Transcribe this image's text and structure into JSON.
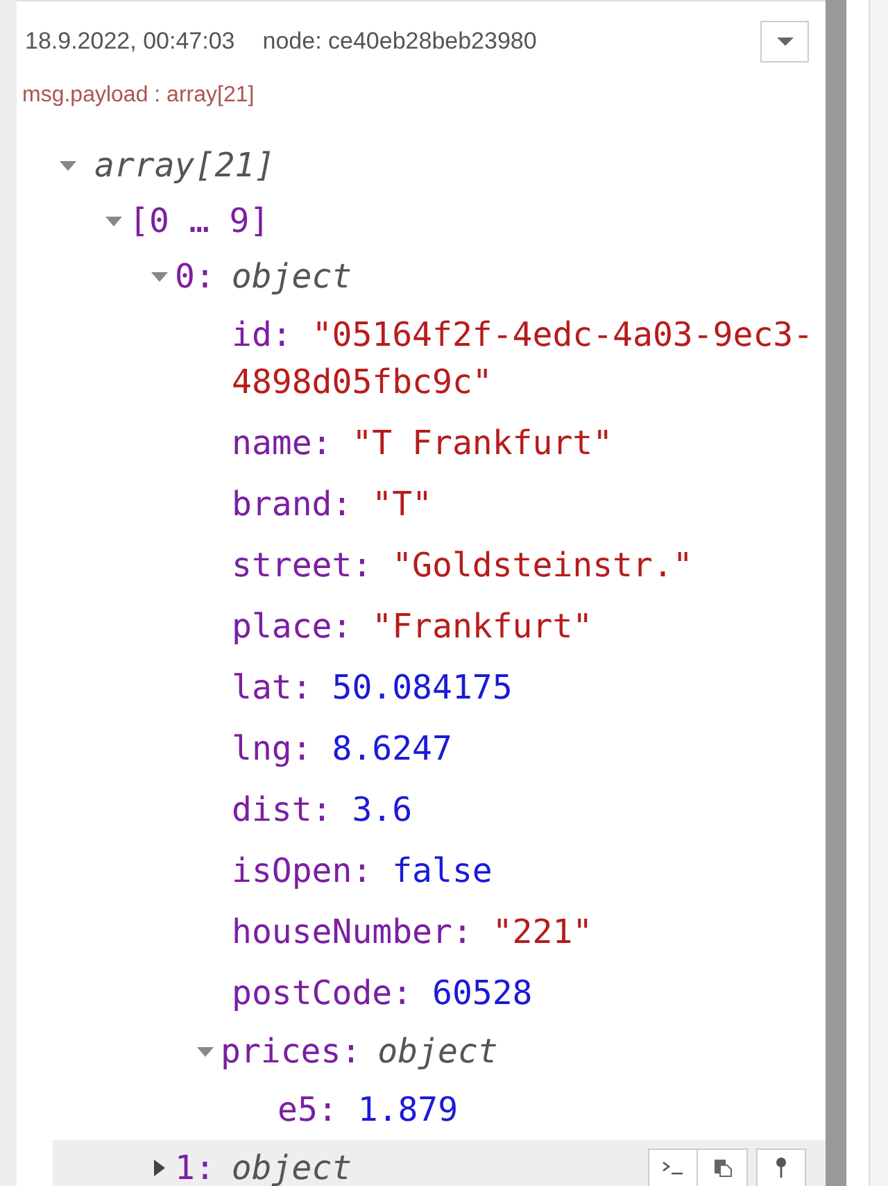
{
  "header": {
    "timestamp": "18.9.2022, 00:47:03",
    "node": "node: ce40eb28beb23980"
  },
  "topic": "msg.payload : array[21]",
  "tree": [
    {
      "kind": "array",
      "summary": "array[21]",
      "expanded": true,
      "children": [
        {
          "kind": "range",
          "summary": "[0 … 9]",
          "expanded": true,
          "children": [
            {
              "kind": "object",
              "key": "0:",
              "summary": "object",
              "expanded": true,
              "highlighted": false,
              "children": [
                {
                  "kind": "string",
                  "key": "id:",
                  "value": "\"05164f2f-4edc-4a03-9ec3-4898d05fbc9c\""
                },
                {
                  "kind": "string",
                  "key": "name:",
                  "value": "\"T Frankfurt\""
                },
                {
                  "kind": "string",
                  "key": "brand:",
                  "value": "\"T\""
                },
                {
                  "kind": "string",
                  "key": "street:",
                  "value": "\"Goldsteinstr.\""
                },
                {
                  "kind": "string",
                  "key": "place:",
                  "value": "\"Frankfurt\""
                },
                {
                  "kind": "number",
                  "key": "lat:",
                  "value": "50.084175"
                },
                {
                  "kind": "number",
                  "key": "lng:",
                  "value": "8.6247"
                },
                {
                  "kind": "number",
                  "key": "dist:",
                  "value": "3.6"
                },
                {
                  "kind": "boolean",
                  "key": "isOpen:",
                  "value": "false"
                },
                {
                  "kind": "string",
                  "key": "houseNumber:",
                  "value": "\"221\""
                },
                {
                  "kind": "number",
                  "key": "postCode:",
                  "value": "60528"
                },
                {
                  "kind": "object",
                  "key": "prices:",
                  "summary": "object",
                  "expanded": true,
                  "children": [
                    {
                      "kind": "number",
                      "key": "e5:",
                      "value": "1.879"
                    }
                  ]
                }
              ]
            },
            {
              "kind": "object",
              "key": "1:",
              "summary": "object",
              "expanded": false,
              "highlighted": true
            }
          ]
        }
      ]
    }
  ]
}
